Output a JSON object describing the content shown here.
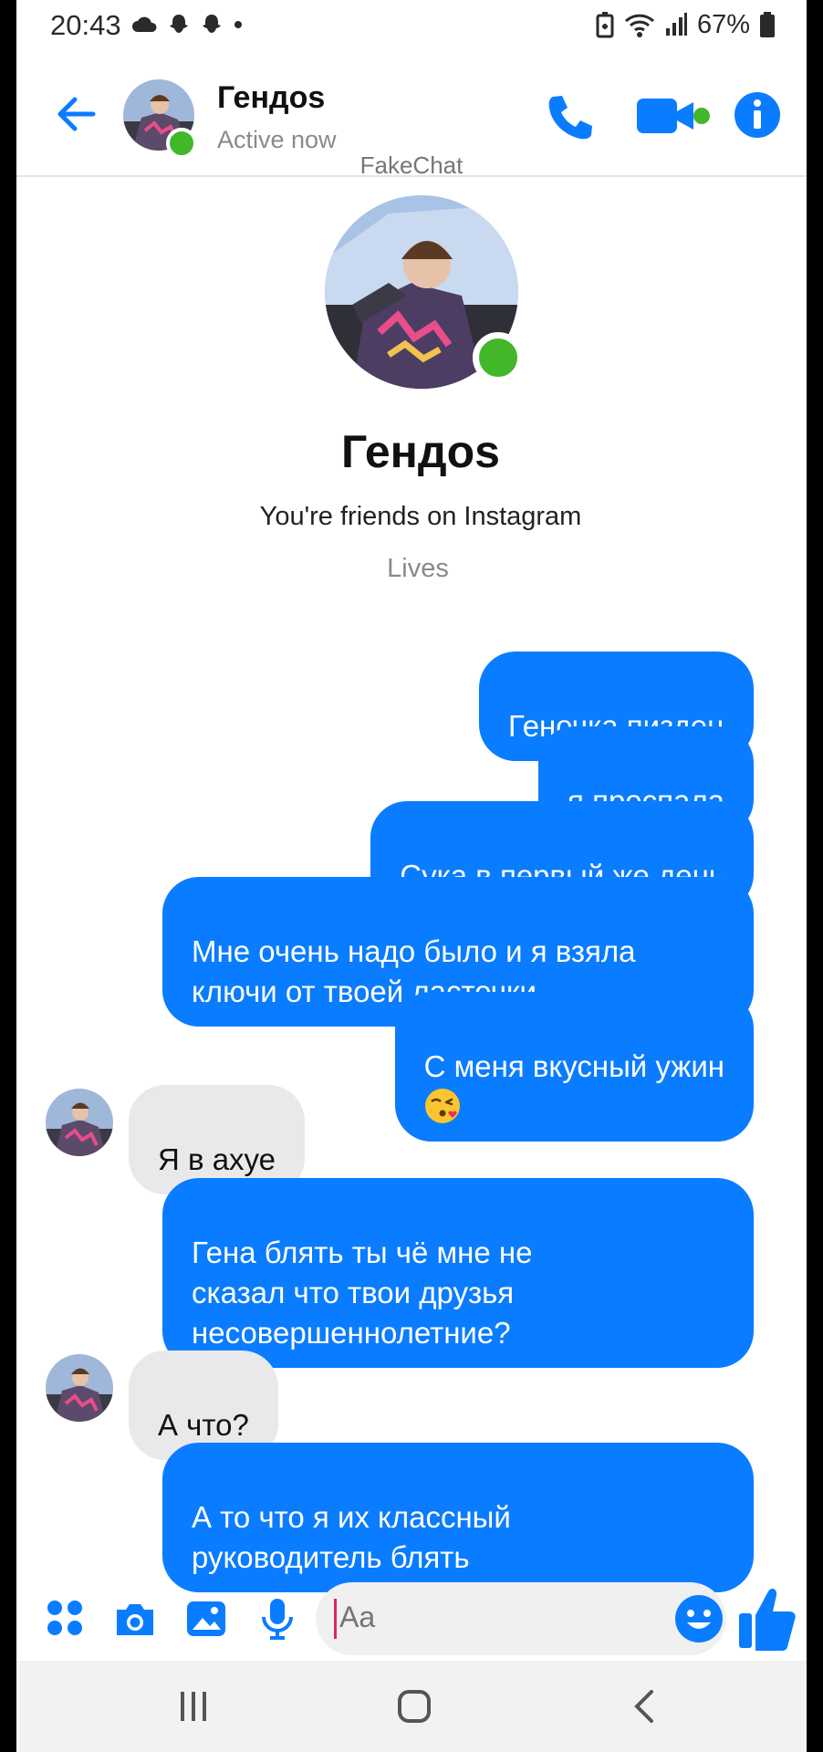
{
  "status_bar": {
    "time": "20:43",
    "battery": "67%",
    "left_icons": [
      "cloud-icon",
      "snapchat-icon",
      "snapchat-icon",
      "dot-icon"
    ],
    "right_icons": [
      "battery-saver-icon",
      "wifi-icon",
      "signal-icon",
      "battery-icon"
    ]
  },
  "header": {
    "contact_name": "Гендоs",
    "status": "Active now",
    "watermark": "FakeChat",
    "icons": [
      "back-arrow-icon",
      "phone-icon",
      "video-camera-icon",
      "info-icon"
    ]
  },
  "profile": {
    "name": "Гендоs",
    "subtitle": "You're friends on Instagram",
    "location": "Lives"
  },
  "messages": [
    {
      "from": "me",
      "text": "Геночка пиздец"
    },
    {
      "from": "me",
      "text": "я проспала"
    },
    {
      "from": "me",
      "text": "Сука в первый же день"
    },
    {
      "from": "me",
      "text": "Мне очень надо было и я взяла\nключи от твоей ласточки"
    },
    {
      "from": "me",
      "text": "С меня вкусный ужин",
      "emoji": "kissing-face-emoji"
    },
    {
      "from": "them",
      "text": "Я в ахуе"
    },
    {
      "from": "me",
      "text": "Гена блять ты чё мне не\nсказал что твои друзья\nнесовершеннолетние?"
    },
    {
      "from": "them",
      "text": "А что?"
    },
    {
      "from": "me",
      "text": "А то что я их классный\nруководитель блять"
    }
  ],
  "composer": {
    "placeholder": "Aa",
    "icons": [
      "apps-grid-icon",
      "camera-icon",
      "gallery-icon",
      "microphone-icon",
      "emoji-icon",
      "thumbs-up-icon"
    ]
  },
  "nav_bar": {
    "icons": [
      "recent-apps-icon",
      "home-icon",
      "back-icon"
    ]
  },
  "colors": {
    "accent": "#0a7cff",
    "online": "#42b72a",
    "incoming_bubble": "#e9e9eb"
  }
}
